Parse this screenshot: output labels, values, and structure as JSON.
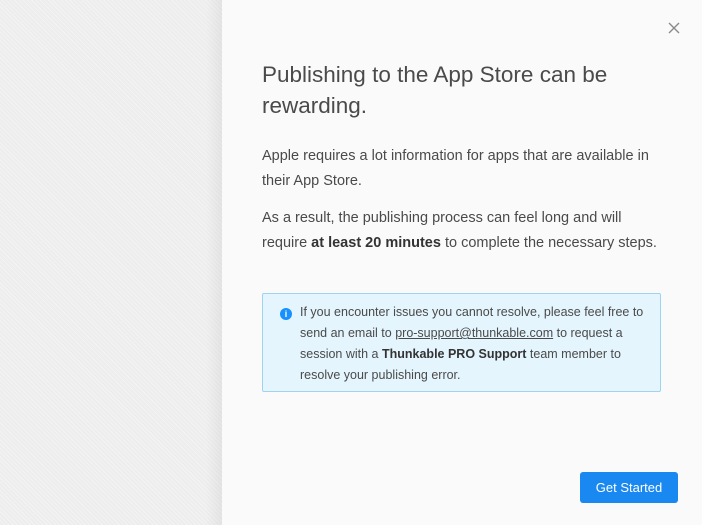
{
  "modal": {
    "title": "Publishing to the App Store can be rewarding.",
    "paragraph_1": "Apple requires a lot information for apps that are available in their App Store.",
    "paragraph_2_before": "As a result, the publishing process can feel long and will require ",
    "paragraph_2_bold": "at least 20 minutes",
    "paragraph_2_after": " to complete the necessary steps.",
    "close_icon": "close-icon",
    "info": {
      "icon": "info-icon",
      "icon_glyph": "i",
      "text_before": "If you encounter issues you cannot resolve, please feel free to send an email to ",
      "email": "pro-support@thunkable.com",
      "text_middle": " to request a session with a ",
      "bold": "Thunkable PRO Support",
      "text_after": " team member to resolve your publishing error."
    },
    "button_label": "Get Started"
  },
  "colors": {
    "accent": "#1a88f1",
    "info_bg": "#e5f5fd",
    "info_border": "#9ed4ef",
    "text": "#4a4a4a"
  }
}
